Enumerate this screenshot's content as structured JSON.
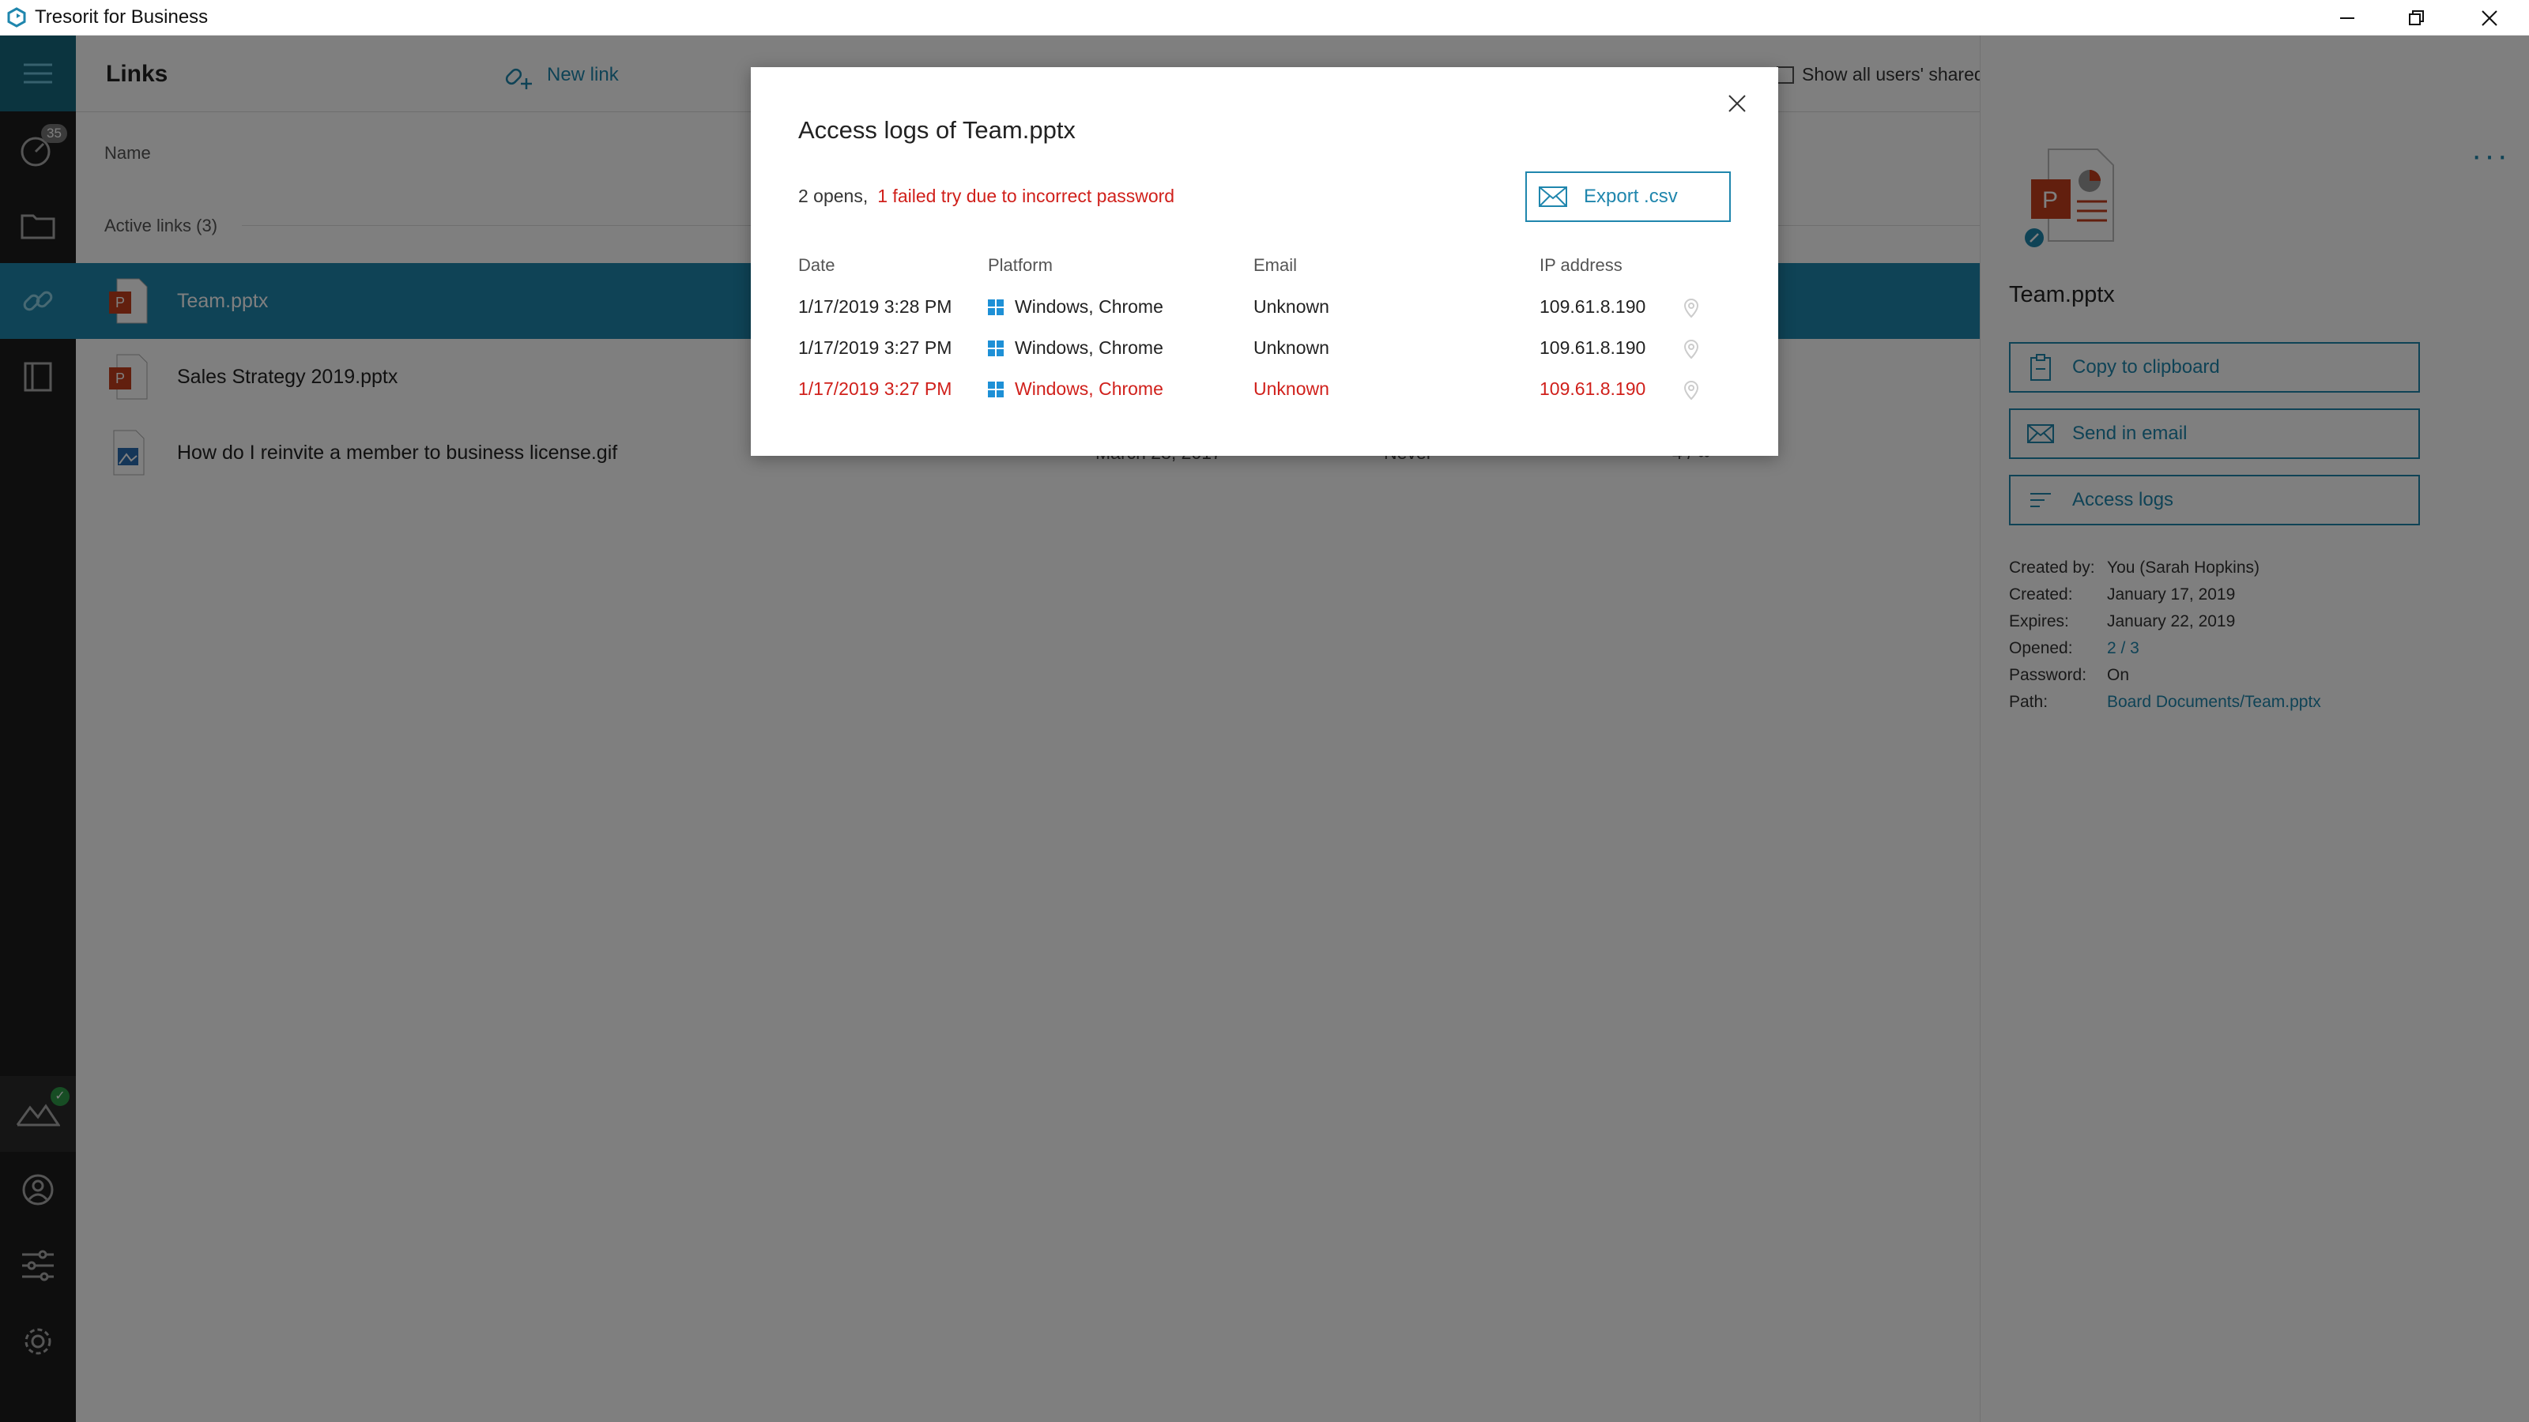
{
  "titlebar": {
    "app_title": "Tresorit for Business",
    "minimize": "—",
    "restore": "❐",
    "close": "✕"
  },
  "sidebar": {
    "activity_badge": "35",
    "items": [
      "menu-icon",
      "activity-icon",
      "folder-icon",
      "link-icon",
      "book-icon",
      "drive-icon",
      "account-icon",
      "filters-icon",
      "gear-icon"
    ]
  },
  "header": {
    "title": "Links",
    "new_link": "New link",
    "show_all": "Show all users' shared links"
  },
  "list": {
    "col_name": "Name",
    "active_links": "Active links (3)",
    "rows": [
      {
        "name": "Team.pptx",
        "type": "pptx",
        "selected": true
      },
      {
        "name": "Sales Strategy 2019.pptx",
        "type": "pptx",
        "selected": false
      },
      {
        "name": "How do I reinvite a member to business license.gif",
        "type": "gif",
        "selected": false,
        "created": "March 28, 2017",
        "expires": "Never",
        "opened": "4 / ∞"
      }
    ]
  },
  "details": {
    "file_name": "Team.pptx",
    "copy": "Copy to clipboard",
    "send": "Send in email",
    "logs": "Access logs",
    "meta": [
      {
        "k": "Created by:",
        "v": "You (Sarah Hopkins)",
        "link": false
      },
      {
        "k": "Created:",
        "v": "January 17, 2019",
        "link": false
      },
      {
        "k": "Expires:",
        "v": "January 22, 2019",
        "link": false
      },
      {
        "k": "Opened:",
        "v": "2 / 3",
        "link": true
      },
      {
        "k": "Password:",
        "v": "On",
        "link": false
      },
      {
        "k": "Path:",
        "v": "Board Documents/Team.pptx",
        "link": true
      }
    ]
  },
  "dialog": {
    "title": "Access logs of Team.pptx",
    "opens": "2 opens,",
    "failed": "1 failed try due to incorrect password",
    "export": "Export .csv",
    "headers": {
      "date": "Date",
      "platform": "Platform",
      "email": "Email",
      "ip": "IP address"
    },
    "rows": [
      {
        "date": "1/17/2019 3:28 PM",
        "platform": "Windows, Chrome",
        "email": "Unknown",
        "ip": "109.61.8.190",
        "failed": false
      },
      {
        "date": "1/17/2019 3:27 PM",
        "platform": "Windows, Chrome",
        "email": "Unknown",
        "ip": "109.61.8.190",
        "failed": false
      },
      {
        "date": "1/17/2019 3:27 PM",
        "platform": "Windows, Chrome",
        "email": "Unknown",
        "ip": "109.61.8.190",
        "failed": true
      }
    ]
  },
  "colors": {
    "accent": "#1f86ad",
    "error": "#d0201b",
    "sidebar": "#1d1d1d"
  }
}
